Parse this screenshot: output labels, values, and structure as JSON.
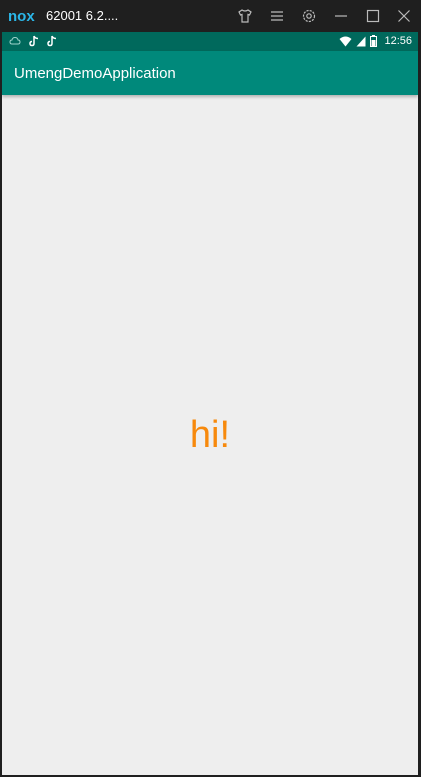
{
  "emulator": {
    "logo_text": "nox",
    "title": "62001 6.2....",
    "buttons": [
      {
        "name": "skin-icon"
      },
      {
        "name": "menu-icon"
      },
      {
        "name": "settings-icon"
      },
      {
        "name": "minimize-icon"
      },
      {
        "name": "maximize-icon"
      },
      {
        "name": "close-icon"
      }
    ]
  },
  "status_bar": {
    "time": "12:56",
    "left_icons": [
      "cloud-notification-icon",
      "tiktok-icon",
      "tiktok-icon"
    ],
    "right_icons": [
      "wifi-icon",
      "cell-signal-icon",
      "battery-icon"
    ]
  },
  "app_bar": {
    "title": "UmengDemoApplication"
  },
  "content": {
    "message": "hi!"
  },
  "colors": {
    "status_bar": "#00695c",
    "app_bar": "#00897b",
    "background": "#eeeeee",
    "message": "#f7890c",
    "nox_logo": "#2bb6e8"
  }
}
